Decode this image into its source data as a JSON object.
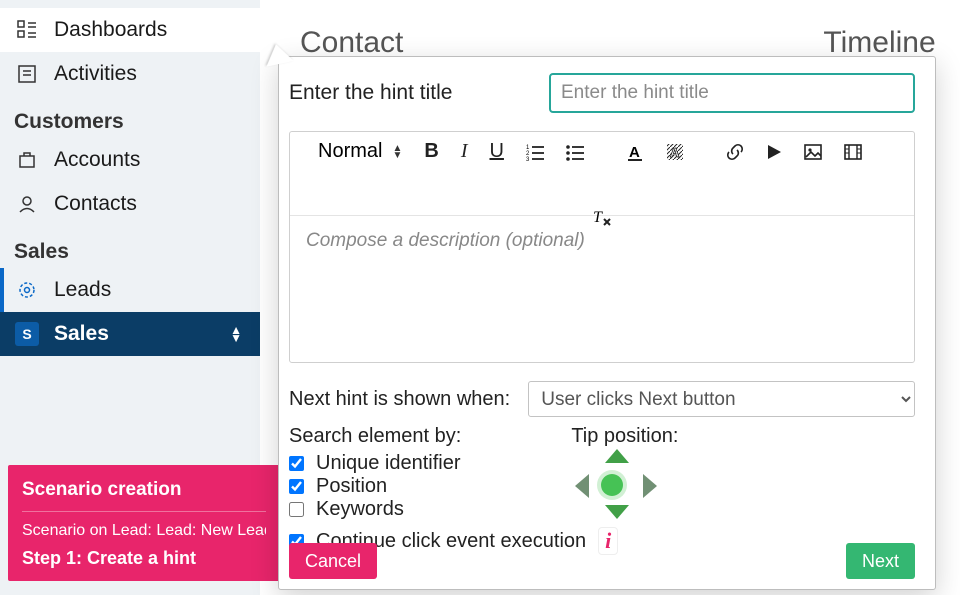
{
  "sidebar": {
    "items": [
      {
        "label": "Dashboards",
        "icon": "dashboard-icon"
      },
      {
        "label": "Activities",
        "icon": "activities-icon"
      }
    ],
    "group1": "Customers",
    "customers": [
      {
        "label": "Accounts",
        "icon": "accounts-icon"
      },
      {
        "label": "Contacts",
        "icon": "contacts-icon"
      }
    ],
    "group2": "Sales",
    "sales": [
      {
        "label": "Leads",
        "icon": "leads-icon"
      },
      {
        "label": "Sales",
        "icon": "S"
      }
    ]
  },
  "scenario": {
    "title": "Scenario creation",
    "line1": "Scenario on Lead: Lead: New Lead",
    "line2": "Step 1: Create a hint"
  },
  "bg": {
    "contact": "Contact",
    "timeline": "Timeline"
  },
  "modal": {
    "title_label": "Enter the hint title",
    "title_placeholder": "Enter the hint title",
    "editor": {
      "format": "Normal",
      "placeholder": "Compose a description (optional)"
    },
    "next_hint_label": "Next hint is shown when:",
    "next_hint_value": "User clicks Next button",
    "search_label": "Search element by:",
    "opts": {
      "unique": "Unique identifier",
      "position": "Position",
      "keywords": "Keywords"
    },
    "tip_label": "Tip position:",
    "continue_label": "Continue click event execution",
    "cancel": "Cancel",
    "next": "Next"
  }
}
